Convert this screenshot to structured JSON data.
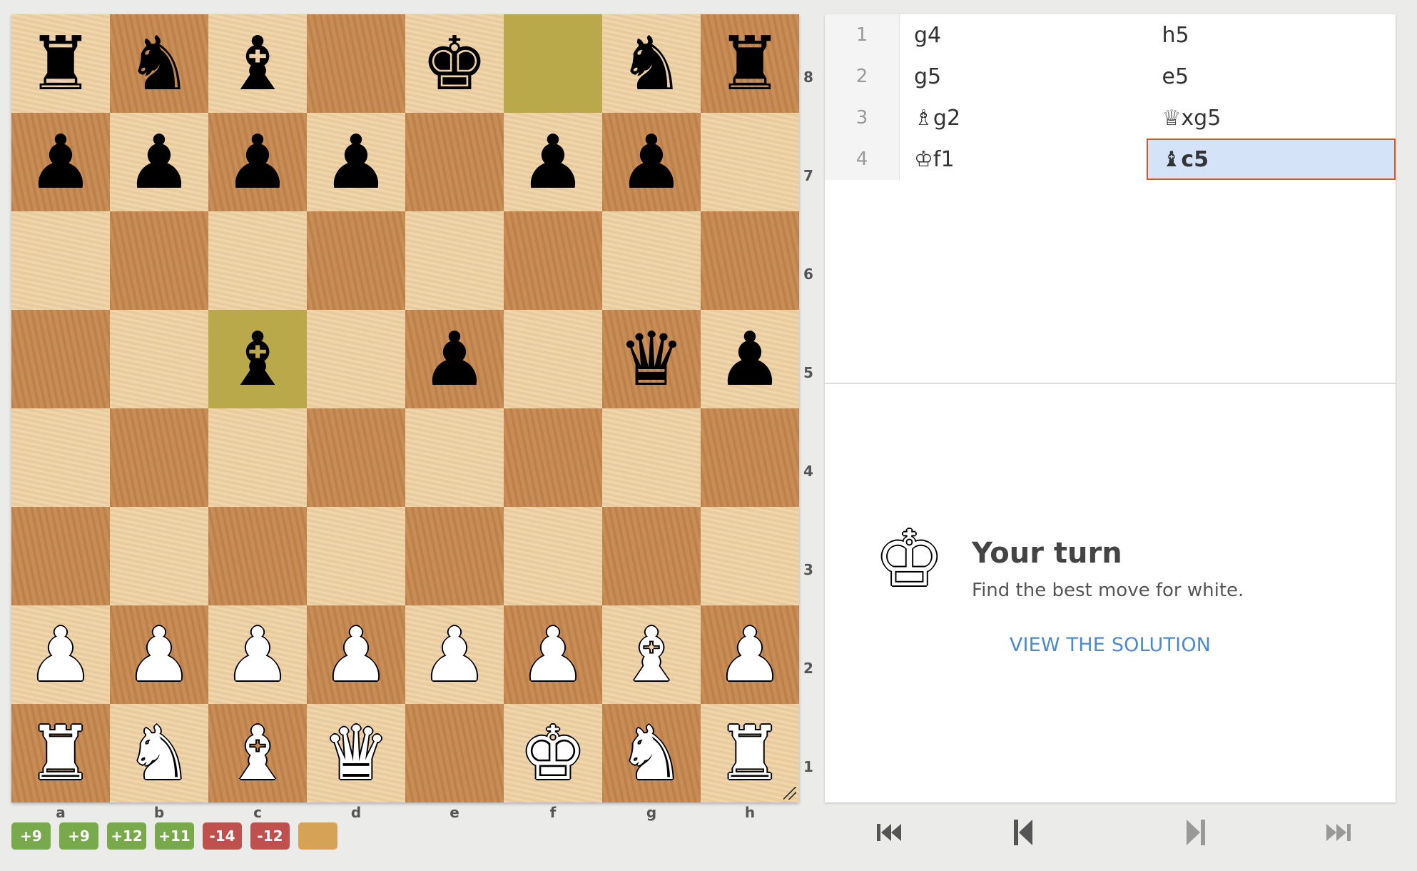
{
  "board": {
    "ranks": [
      "8",
      "7",
      "6",
      "5",
      "4",
      "3",
      "2",
      "1"
    ],
    "files": [
      "a",
      "b",
      "c",
      "d",
      "e",
      "f",
      "g",
      "h"
    ],
    "position": [
      [
        "br",
        "bn",
        "bb",
        "",
        "bk",
        "",
        "bn",
        "br"
      ],
      [
        "bp",
        "bp",
        "bp",
        "bp",
        "",
        "bp",
        "bp",
        ""
      ],
      [
        "",
        "",
        "",
        "",
        "",
        "",
        "",
        ""
      ],
      [
        "",
        "",
        "bb",
        "",
        "bp",
        "",
        "bq",
        "bp"
      ],
      [
        "",
        "",
        "",
        "",
        "",
        "",
        "",
        ""
      ],
      [
        "",
        "",
        "",
        "",
        "",
        "",
        "",
        ""
      ],
      [
        "wp",
        "wp",
        "wp",
        "wp",
        "wp",
        "wp",
        "wb",
        "wp"
      ],
      [
        "wr",
        "wn",
        "wb",
        "wq",
        "",
        "wk",
        "wn",
        "wr"
      ]
    ],
    "highlighted_squares": [
      "f8",
      "c5"
    ]
  },
  "evaluations": [
    {
      "label": "+9",
      "kind": "pos"
    },
    {
      "label": "+9",
      "kind": "pos"
    },
    {
      "label": "+12",
      "kind": "pos"
    },
    {
      "label": "+11",
      "kind": "pos"
    },
    {
      "label": "-14",
      "kind": "neg"
    },
    {
      "label": "-12",
      "kind": "neg"
    },
    {
      "label": "",
      "kind": "cur"
    }
  ],
  "moves": [
    {
      "num": "1",
      "white": "g4",
      "black": "h5"
    },
    {
      "num": "2",
      "white": "g5",
      "black": "e5"
    },
    {
      "num": "3",
      "white": "♗g2",
      "black": "♕xg5"
    },
    {
      "num": "4",
      "white": "♔f1",
      "black": "♝c5"
    }
  ],
  "active_move": {
    "row": 3,
    "side": "black"
  },
  "turn": {
    "title": "Your turn",
    "subtitle": "Find the best move for white.",
    "icon": "white-king-icon"
  },
  "solution_link": "VIEW THE SOLUTION",
  "nav": [
    "first-move-icon",
    "previous-move-icon",
    "next-move-icon",
    "last-move-icon"
  ]
}
